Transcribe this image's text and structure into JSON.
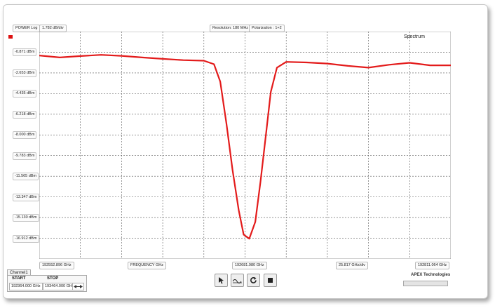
{
  "toolbar": {
    "power_mode": "POWER Log",
    "scale": "1.782 dB/div",
    "resolution": "Resolution: 180 MHz",
    "polarization": "Polarization : 1+2"
  },
  "chart_data": {
    "type": "line",
    "title": "Spectrum",
    "xlabel": "FREQUENCY GHz",
    "ylabel": "",
    "y_tick_labels": [
      "-0.871 dBm",
      "-2.653 dBm",
      "-4.435 dBm",
      "-6.218 dBm",
      "-8.000 dBm",
      "-9.783 dBm",
      "-11.565 dBm",
      "-13.347 dBm",
      "-15.130 dBm",
      "-16.912 dBm"
    ],
    "ylim": [
      -18.694,
      0.911
    ],
    "xlim": [
      192552.896,
      192811.064
    ],
    "x_tick_labels": {
      "start": "192552.896 GHz",
      "center": "192681.980 GHz",
      "stop": "192811.064 GHz",
      "span_per_div": "25.817 GHz/div"
    },
    "grid": true,
    "series": [
      {
        "color": "#e31b1b",
        "x": [
          192552.9,
          192565.8,
          192578.7,
          192591.6,
          192604.5,
          192617.4,
          192630.3,
          192643.2,
          192656.1,
          192662.5,
          192666.4,
          192670.3,
          192674.1,
          192678.0,
          192681.1,
          192684.6,
          192688.4,
          192691.7,
          192695.5,
          192698.1,
          192702.0,
          192707.8,
          192720.7,
          192733.6,
          192746.5,
          192759.4,
          192772.3,
          192785.2,
          192798.1,
          192811.1
        ],
        "y": [
          -1.15,
          -1.32,
          -1.2,
          -1.1,
          -1.18,
          -1.32,
          -1.44,
          -1.55,
          -1.6,
          -1.9,
          -3.4,
          -7.0,
          -11.0,
          -14.5,
          -16.6,
          -16.95,
          -15.5,
          -12.0,
          -7.5,
          -4.3,
          -2.2,
          -1.7,
          -1.75,
          -1.85,
          -2.05,
          -2.2,
          -1.95,
          -1.78,
          -2.0,
          -2.0
        ]
      }
    ]
  },
  "channel": {
    "tab_label": "Channel1",
    "start_label": "START",
    "stop_label": "STOP",
    "start_value": "192364.000 GHz",
    "stop_value": "193464.000 GHz"
  },
  "brand": "APEX Technologies"
}
